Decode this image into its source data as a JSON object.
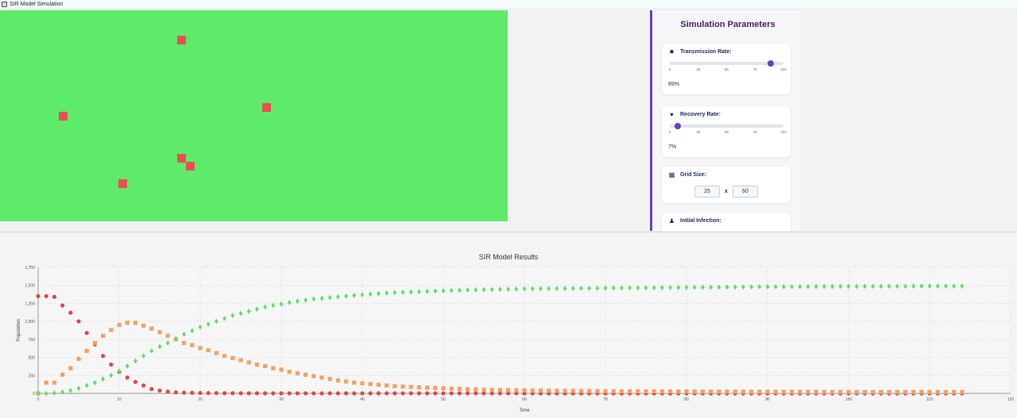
{
  "window": {
    "title": "SIR Model Simulation"
  },
  "grid": {
    "background": "#5feb6a",
    "infected_color": "#e85050",
    "infected_cells_label": "infected cells"
  },
  "settings": {
    "heading": "Simulation Parameters",
    "transmission": {
      "label": "Transmission Rate:",
      "value": 89,
      "value_text": "89%",
      "ticks": [
        "0",
        "25",
        "50",
        "75",
        "100"
      ]
    },
    "recovery": {
      "label": "Recovery Rate:",
      "value": 7,
      "value_text": "7%",
      "ticks": [
        "0",
        "25",
        "50",
        "75",
        "100"
      ]
    },
    "grid_size": {
      "label": "Grid Size:",
      "rows": "25",
      "times": "x",
      "cols": "60"
    },
    "initial_infection": {
      "label": "Initial Infection:"
    },
    "accent_color": "#6a3fc4"
  },
  "chart_data": {
    "type": "scatter",
    "title": "SIR Model Results",
    "xlabel": "Time",
    "ylabel": "Population",
    "xlim": [
      0,
      120
    ],
    "ylim": [
      0,
      1750
    ],
    "xticks": [
      0,
      10,
      20,
      30,
      40,
      50,
      60,
      70,
      80,
      90,
      100,
      110,
      120
    ],
    "yticks": [
      0,
      250,
      500,
      750,
      1000,
      1250,
      1500,
      1750
    ],
    "ytick_labels": [
      "0",
      "250",
      "500",
      "750",
      "1,000",
      "1,250",
      "1,500",
      "1,750"
    ],
    "grid": true,
    "series": [
      {
        "color": "#e0474c",
        "marker": "circle",
        "values": [
          1350,
          1350,
          1340,
          1220,
          1120,
          1000,
          840,
          680,
          520,
          400,
          300,
          220,
          160,
          110,
          60,
          40,
          25,
          15,
          10,
          8,
          6,
          5,
          4,
          3,
          3,
          2,
          2,
          2,
          1,
          1,
          1,
          1,
          1,
          1,
          1,
          1,
          1,
          1,
          1,
          1,
          1,
          1,
          1,
          1,
          1,
          1,
          1,
          1,
          1,
          1,
          1,
          1,
          1,
          1,
          1,
          1,
          1,
          1,
          1,
          1,
          0,
          0,
          0,
          0,
          0,
          0,
          0,
          0,
          0,
          0,
          0,
          0,
          0,
          0,
          0,
          0,
          0,
          0,
          0,
          0,
          0,
          0,
          0,
          0,
          0,
          0,
          0,
          0,
          0,
          0,
          0,
          0,
          0,
          0,
          0,
          0,
          0,
          0,
          0,
          0,
          0,
          0,
          0,
          0,
          0,
          0,
          0,
          0,
          0,
          0,
          0,
          0,
          0,
          0,
          0
        ]
      },
      {
        "color": "#f4a162",
        "marker": "square",
        "values": [
          0,
          150,
          150,
          260,
          350,
          480,
          590,
          700,
          800,
          880,
          950,
          980,
          980,
          940,
          900,
          850,
          800,
          750,
          700,
          670,
          630,
          600,
          560,
          520,
          490,
          460,
          430,
          400,
          380,
          350,
          330,
          300,
          280,
          260,
          240,
          220,
          200,
          180,
          165,
          150,
          140,
          130,
          120,
          110,
          100,
          95,
          90,
          85,
          80,
          75,
          70,
          66,
          62,
          58,
          55,
          52,
          50,
          48,
          46,
          44,
          42,
          40,
          39,
          38,
          37,
          36,
          35,
          34,
          33,
          32,
          31,
          30,
          30,
          29,
          29,
          28,
          28,
          27,
          27,
          26,
          26,
          26,
          25,
          25,
          25,
          24,
          24,
          24,
          23,
          23,
          23,
          23,
          22,
          22,
          22,
          22,
          22,
          21,
          21,
          21,
          21,
          21,
          21,
          20,
          20,
          20,
          20,
          20,
          20,
          20,
          20,
          20,
          20,
          20,
          20
        ]
      },
      {
        "color": "#5fe06a",
        "marker": "diamond",
        "values": [
          0,
          0,
          5,
          20,
          40,
          70,
          110,
          150,
          200,
          250,
          310,
          380,
          450,
          520,
          590,
          650,
          700,
          760,
          820,
          870,
          920,
          960,
          1000,
          1040,
          1080,
          1110,
          1140,
          1170,
          1200,
          1220,
          1240,
          1260,
          1280,
          1295,
          1310,
          1320,
          1330,
          1340,
          1350,
          1360,
          1370,
          1378,
          1385,
          1392,
          1398,
          1403,
          1408,
          1412,
          1416,
          1420,
          1424,
          1428,
          1431,
          1434,
          1437,
          1440,
          1442,
          1444,
          1446,
          1448,
          1450,
          1452,
          1453,
          1454,
          1455,
          1456,
          1457,
          1458,
          1459,
          1460,
          1461,
          1462,
          1463,
          1464,
          1465,
          1466,
          1467,
          1468,
          1469,
          1470,
          1471,
          1472,
          1473,
          1474,
          1475,
          1476,
          1477,
          1478,
          1479,
          1480,
          1480,
          1481,
          1481,
          1482,
          1482,
          1483,
          1483,
          1484,
          1484,
          1485,
          1485,
          1485,
          1486,
          1486,
          1486,
          1487,
          1487,
          1487,
          1488,
          1488,
          1488,
          1488,
          1489,
          1489,
          1490
        ]
      }
    ]
  }
}
